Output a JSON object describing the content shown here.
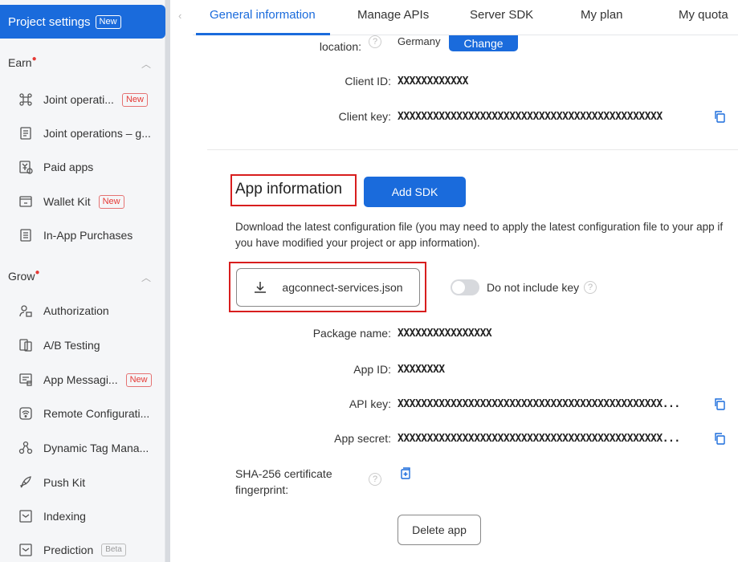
{
  "sidebar": {
    "header": {
      "title": "Project settings",
      "badge": "New"
    },
    "groups": [
      {
        "label": "Earn"
      },
      {
        "label": "Grow"
      }
    ],
    "items": [
      {
        "label": "Joint operati...",
        "badge": "New"
      },
      {
        "label": "Joint operations – g..."
      },
      {
        "label": "Paid apps"
      },
      {
        "label": "Wallet Kit",
        "badge": "New"
      },
      {
        "label": "In-App Purchases"
      },
      {
        "label": "Authorization"
      },
      {
        "label": "A/B Testing"
      },
      {
        "label": "App Messagi...",
        "badge": "New"
      },
      {
        "label": "Remote Configurati..."
      },
      {
        "label": "Dynamic Tag Mana..."
      },
      {
        "label": "Push Kit"
      },
      {
        "label": "Indexing"
      },
      {
        "label": "Prediction",
        "badge": "Beta"
      }
    ]
  },
  "tabs": [
    "General information",
    "Manage APIs",
    "Server SDK",
    "My plan",
    "My quota"
  ],
  "project": {
    "location_label": "location:",
    "location_value": "Germany",
    "change_button": "Change",
    "client_id_label": "Client ID:",
    "client_id_value": "XXXXXXXXXXXX",
    "client_key_label": "Client key:",
    "client_key_value": "XXXXXXXXXXXXXXXXXXXXXXXXXXXXXXXXXXXXXXXXXXXXX"
  },
  "app_info": {
    "title": "App information",
    "add_sdk_button": "Add SDK",
    "description": "Download the latest configuration file (you may need to apply the latest configuration file to your app if you have modified your project or app information).",
    "download_file": "agconnect-services.json",
    "toggle_label": "Do not include key",
    "package_name_label": "Package name:",
    "package_name_value": "XXXXXXXXXXXXXXXX",
    "app_id_label": "App ID:",
    "app_id_value": "XXXXXXXX",
    "api_key_label": "API key:",
    "api_key_value": "XXXXXXXXXXXXXXXXXXXXXXXXXXXXXXXXXXXXXXXXXXXXX...",
    "app_secret_label": "App secret:",
    "app_secret_value": "XXXXXXXXXXXXXXXXXXXXXXXXXXXXXXXXXXXXXXXXXXXXX...",
    "sha_label_line1": "SHA-256 certificate",
    "sha_label_line2": "fingerprint:",
    "delete_button": "Delete app"
  },
  "colors": {
    "accent": "#1a6bdc",
    "highlight": "#d81e1e",
    "new_badge": "#e53935"
  }
}
